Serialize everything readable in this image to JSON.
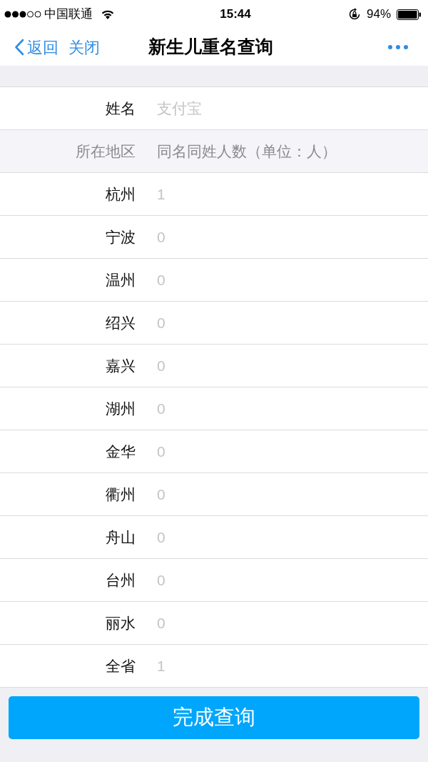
{
  "status_bar": {
    "carrier": "中国联通",
    "time": "15:44",
    "battery": "94%"
  },
  "nav": {
    "back": "返回",
    "close": "关闭",
    "title": "新生儿重名查询"
  },
  "name_row": {
    "label": "姓名",
    "value": "支付宝"
  },
  "table": {
    "columns": [
      "所在地区",
      "同名同姓人数（单位：人）"
    ],
    "rows": [
      {
        "region": "杭州",
        "count": "1"
      },
      {
        "region": "宁波",
        "count": "0"
      },
      {
        "region": "温州",
        "count": "0"
      },
      {
        "region": "绍兴",
        "count": "0"
      },
      {
        "region": "嘉兴",
        "count": "0"
      },
      {
        "region": "湖州",
        "count": "0"
      },
      {
        "region": "金华",
        "count": "0"
      },
      {
        "region": "衢州",
        "count": "0"
      },
      {
        "region": "舟山",
        "count": "0"
      },
      {
        "region": "台州",
        "count": "0"
      },
      {
        "region": "丽水",
        "count": "0"
      },
      {
        "region": "全省",
        "count": "1"
      }
    ]
  },
  "button": "完成查询"
}
